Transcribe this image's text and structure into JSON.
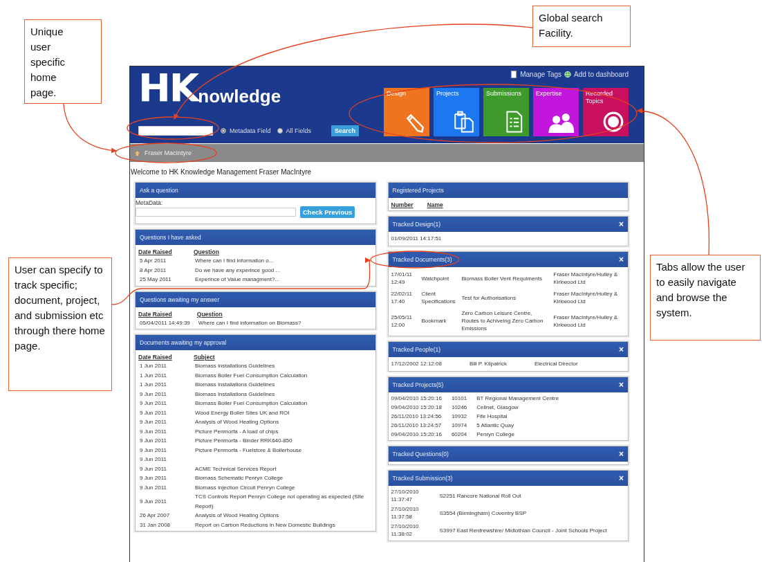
{
  "callouts": [
    {
      "text": "Unique user specific home page."
    },
    {
      "text": "Global search Facility."
    },
    {
      "text": "User can specify to track specific; document, project, and submission etc through there home page."
    },
    {
      "text": "Tabs allow the user to easily navigate and browse the system."
    }
  ],
  "header": {
    "logo_mark": "HK",
    "logo_word": "nowledge",
    "links": [
      "Manage Tags",
      "Add to dashboard"
    ],
    "radios": [
      {
        "label": "Metadata Field",
        "selected": true
      },
      {
        "label": "All Fields",
        "selected": false
      }
    ],
    "search_button": "Search",
    "tabs": [
      {
        "label": "Design",
        "color": "#ef7420"
      },
      {
        "label": "Projects",
        "color": "#1c78f0"
      },
      {
        "label": "Submissions",
        "color": "#3f9a2c"
      },
      {
        "label": "Expertise",
        "color": "#c316dc"
      },
      {
        "label": "Recorded Topics",
        "color": "#c8105e"
      }
    ]
  },
  "breadcrumb": "Fraser MacIntyre",
  "welcome": "Welcome to HK Knowledge Management Fraser MacIntyre",
  "left_panels": [
    {
      "title": "Ask a question",
      "kind": "form",
      "label": "MetaData:",
      "button": "Check Previous"
    },
    {
      "title": "Questions I have asked",
      "kind": "table",
      "headers": [
        "Date Raised",
        "Question"
      ],
      "rows": [
        [
          "5 Apr 2011",
          "Where can I find information o..."
        ],
        [
          "8 Apr 2011",
          "Do we have any experince good ..."
        ],
        [
          "25 May 2011",
          "Experince of Value managment?..."
        ]
      ]
    },
    {
      "title": "Questions awaiting my answer",
      "kind": "table",
      "headers": [
        "Date Raised",
        "Question"
      ],
      "rows": [
        [
          "05/04/2011 14:49:39",
          "Where can I find information on Biomass?"
        ]
      ]
    },
    {
      "title": "Documents awaiting my approval",
      "kind": "table",
      "headers": [
        "Date Raised",
        "Subject"
      ],
      "rows": [
        [
          "1 Jun 2011",
          "Biomass Installations Guidelines"
        ],
        [
          "1 Jun 2011",
          "Biomass Boiler Fuel Consumption Calculation"
        ],
        [
          "1 Jun 2011",
          "Biomass Installations Guidelines"
        ],
        [
          "9 Jun 2011",
          "Biomass Installations Guidelines"
        ],
        [
          "9 Jun 2011",
          "Biomass Boiler Fuel Consumption Calculation"
        ],
        [
          "9 Jun 2011",
          "Wood Energy Boiler Sites UK and ROI"
        ],
        [
          "9 Jun 2011",
          "Analysis of Wood Heating Options"
        ],
        [
          "9 Jun 2011",
          "Picture Penmorfa - A load of chips"
        ],
        [
          "9 Jun 2011",
          "Picture Penmorfa - Binder RRK640-850"
        ],
        [
          "9 Jun 2011",
          "Picture Penmorfa - Fuelstore & Boilerhouse"
        ],
        [
          "9 Jun 2011"
        ],
        [
          "9 Jun 2011",
          "ACME Technical Services Report"
        ],
        [
          "9 Jun 2011",
          "Biomass Schematic Penryn College"
        ],
        [
          "9 Jun 2011",
          "Biomass Injection Circuit Penryn College"
        ],
        [
          "9 Jun 2011",
          "TCS Controls Report Penryn College not operating as expected (Site Report)"
        ],
        [
          "26 Apr 2007",
          "Analysis of Wood Heating Options"
        ],
        [
          "31 Jan 2008",
          "Report on Carbon Reductions in New Domestic Buildings"
        ]
      ]
    }
  ],
  "right_panels": [
    {
      "title": "Registered Projects",
      "kind": "table",
      "headers": [
        "Number",
        "Name"
      ]
    },
    {
      "title": "Tracked Design(1)",
      "kind": "table",
      "close": "×",
      "rows": [
        [
          "01/09/2011 14:17:51"
        ]
      ]
    },
    {
      "title": "Tracked Documents(3)",
      "kind": "table",
      "close": "×",
      "rows": [
        [
          "17/01/11 12:49",
          "Watchpoint",
          "Biomass Boiler Vent Requiments",
          "Fraser MacIntyre/Hulley & Kirkwood Ltd"
        ],
        [
          "22/02/11 17:40",
          "Client Specifications",
          "Test for Authorisations",
          "Fraser MacIntyre/Hulley & Kirkwood Ltd"
        ],
        [
          "25/05/11 12:00",
          "Bookmark",
          "Zero Carbon Leisure Centre, Routes to Achiveing Zero Carbon Emissions",
          "Fraser MacIntyre/Hulley & Kirkwood Ltd"
        ]
      ]
    },
    {
      "title": "Tracked People(1)",
      "kind": "table",
      "close": "×",
      "rows": [
        [
          "17/12/2002 12:12:08",
          "Bill P. Kilpatrick",
          "Electrical Director"
        ]
      ]
    },
    {
      "title": "Tracked Projects(5)",
      "kind": "table",
      "close": "×",
      "rows": [
        [
          "09/04/2010 15:20:16",
          "10101",
          "BT Regional Management Centre"
        ],
        [
          "09/04/2010 15:20:18",
          "10246",
          "Cellnet, Glasgow"
        ],
        [
          "26/11/2010 13:24:56",
          "10932",
          "Fife Hospital"
        ],
        [
          "26/11/2010 13:24:57",
          "10974",
          "5 Atlantic Quay"
        ],
        [
          "09/04/2010 15:20:16",
          "60204",
          "Penryn College"
        ]
      ]
    },
    {
      "title": "Tracked Questions(0)",
      "kind": "table",
      "close": "×"
    },
    {
      "title": "Tracked Submission(3)",
      "kind": "table",
      "close": "×",
      "rows": [
        [
          "27/10/2010 11:37:47",
          "S2251",
          "Rancore National Roll Out"
        ],
        [
          "27/10/2010 11:37:58",
          "S3554",
          "(Birmingham) Coventry BSP"
        ],
        [
          "27/10/2010 11:38:02",
          "S3997",
          "East Renfrewshire/ Midlothian Council - Joint Schools Project"
        ]
      ]
    }
  ]
}
